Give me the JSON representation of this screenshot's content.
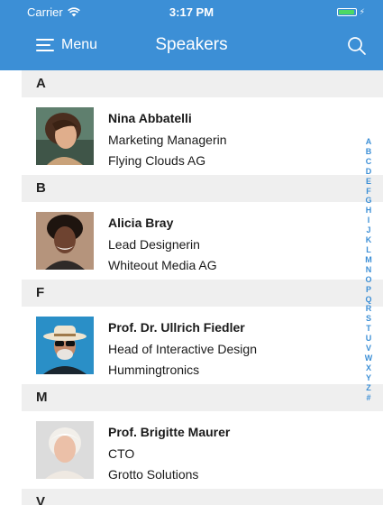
{
  "status_bar": {
    "carrier": "Carrier",
    "time": "3:17 PM",
    "battery_level": 0.95,
    "battery_color": "#4cd964"
  },
  "nav": {
    "menu_label": "Menu",
    "title": "Speakers",
    "menu_icon": "hamburger-icon",
    "search_icon": "search-icon",
    "color": "#3c8fd6"
  },
  "sections": [
    {
      "letter": "A",
      "speakers": [
        {
          "name": "Nina Abbatelli",
          "role": "Marketing Managerin",
          "company": "Flying Clouds AG"
        }
      ]
    },
    {
      "letter": "B",
      "speakers": [
        {
          "name": "Alicia Bray",
          "role": "Lead Designerin",
          "company": "Whiteout Media AG"
        }
      ]
    },
    {
      "letter": "F",
      "speakers": [
        {
          "name": "Prof. Dr. Ullrich Fiedler",
          "role": "Head of Interactive Design",
          "company": "Hummingtronics"
        }
      ]
    },
    {
      "letter": "M",
      "speakers": [
        {
          "name": "Prof. Brigitte Maurer",
          "role": "CTO",
          "company": "Grotto Solutions"
        }
      ]
    },
    {
      "letter": "V",
      "speakers": []
    }
  ],
  "index_letters": [
    "A",
    "B",
    "C",
    "D",
    "E",
    "F",
    "G",
    "H",
    "I",
    "J",
    "K",
    "L",
    "M",
    "N",
    "O",
    "P",
    "Q",
    "R",
    "S",
    "T",
    "U",
    "V",
    "W",
    "X",
    "Y",
    "Z",
    "#"
  ]
}
